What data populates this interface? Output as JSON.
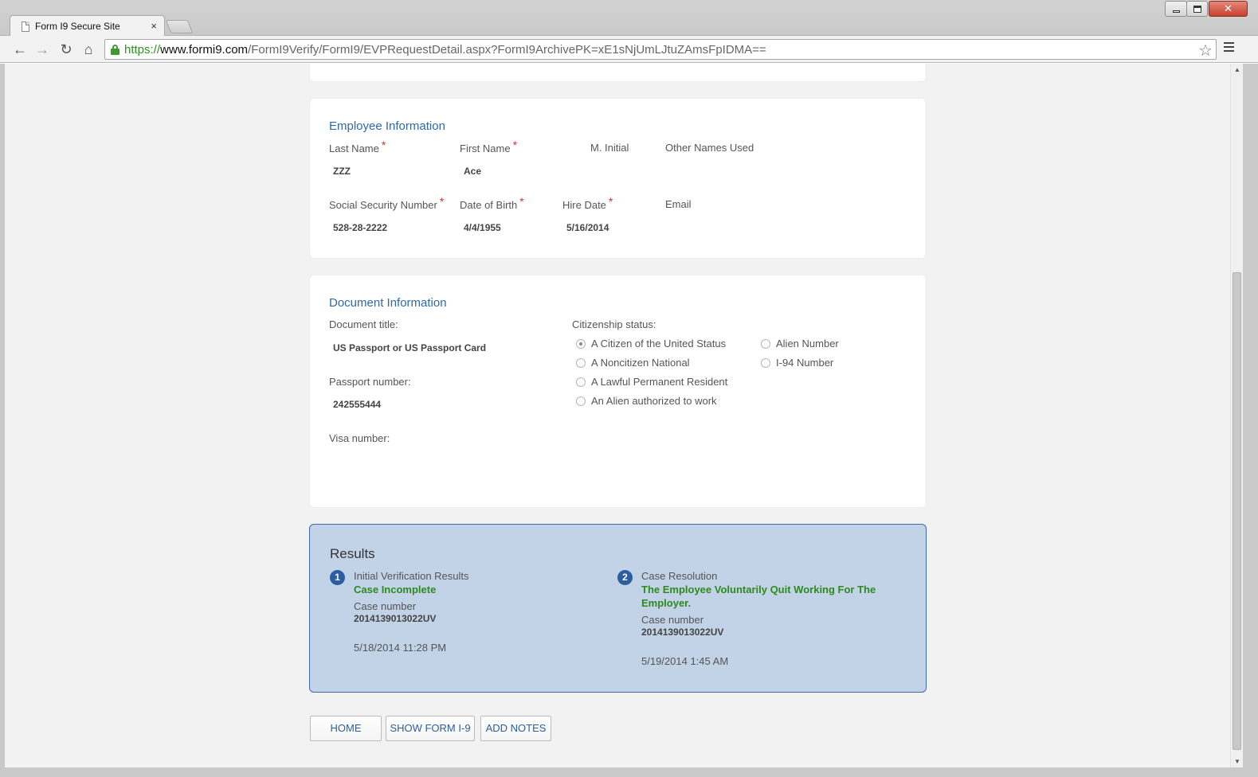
{
  "browser": {
    "tab_title": "Form I9 Secure Site",
    "tab_close": "×",
    "url_scheme": "https://",
    "url_host": "www.formi9.com",
    "url_path": "/FormI9Verify/FormI9/EVPRequestDetail.aspx?FormI9ArchivePK=xE1sNjUmLJtuZAmsFpIDMA==",
    "icons": {
      "back": "←",
      "forward": "→",
      "reload": "↻",
      "home": "⌂",
      "star": "☆",
      "close": "✕"
    }
  },
  "employee": {
    "title": "Employee Information",
    "required_mark": "*",
    "last_name_label": "Last Name",
    "last_name_value": "ZZZ",
    "first_name_label": "First Name",
    "first_name_value": "Ace",
    "middle_initial_label": "M. Initial",
    "other_names_label": "Other Names Used",
    "ssn_label": "Social Security Number",
    "ssn_value": "528-28-2222",
    "dob_label": "Date of Birth",
    "dob_value": "4/4/1955",
    "hire_date_label": "Hire Date",
    "hire_date_value": "5/16/2014",
    "email_label": "Email"
  },
  "document": {
    "title": "Document Information",
    "doc_title_label": "Document title:",
    "doc_title_value": "US Passport or US Passport Card",
    "passport_label": "Passport number:",
    "passport_value": "242555444",
    "visa_label": "Visa number:",
    "citizenship_label": "Citizenship status:",
    "citizenship_options": [
      {
        "label": "A Citizen of the United Status",
        "checked": true
      },
      {
        "label": "A Noncitizen National",
        "checked": false
      },
      {
        "label": "A Lawful Permanent Resident",
        "checked": false
      },
      {
        "label": "An Alien authorized to work",
        "checked": false
      }
    ],
    "number_options": [
      {
        "label": "Alien Number",
        "checked": false
      },
      {
        "label": "I-94 Number",
        "checked": false
      }
    ]
  },
  "results": {
    "title": "Results",
    "steps": [
      {
        "number": "1",
        "label": "Initial Verification Results",
        "status": "Case Incomplete",
        "case_label": "Case number",
        "case_number": "2014139013022UV",
        "date": "5/18/2014 11:28 PM"
      },
      {
        "number": "2",
        "label": "Case Resolution",
        "status": "The Employee Voluntarily Quit Working For The Employer.",
        "case_label": "Case number",
        "case_number": "2014139013022UV",
        "date": "5/19/2014 1:45 AM"
      }
    ]
  },
  "buttons": {
    "home": "HOME",
    "show_form": "SHOW FORM I-9",
    "add_notes": "ADD NOTES"
  },
  "colors": {
    "section_title": "#2f6aa8",
    "required": "#d0312d",
    "status_green": "#2e8a1e",
    "results_bg": "#c2d2e7",
    "results_border": "#3e6aab",
    "badge": "#2b5da0"
  }
}
